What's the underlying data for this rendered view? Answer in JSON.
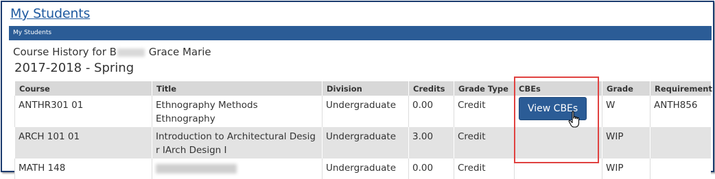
{
  "header": {
    "title": "My Students",
    "section_label": "My Students"
  },
  "history": {
    "prefix": "Course History for B",
    "suffix": "Grace Marie",
    "term": "2017-2018 - Spring"
  },
  "table": {
    "columns": [
      "Course",
      "Title",
      "Division",
      "Credits",
      "Grade Type",
      "CBEs",
      "Grade",
      "Requirement"
    ],
    "rows": [
      {
        "course": "ANTHR301 01",
        "title": "Ethnography Methods Ethnography",
        "division": "Undergraduate",
        "credits": "0.00",
        "grade_type": "Credit",
        "cbe_button": "View CBEs",
        "grade": "W",
        "requirement": "ANTH856"
      },
      {
        "course": "ARCH 101 01",
        "title": "Introduction to Architectural Desig r IArch Design I",
        "division": "Undergraduate",
        "credits": "3.00",
        "grade_type": "Credit",
        "grade": "WIP",
        "requirement": ""
      },
      {
        "course": "MATH 148",
        "title": "",
        "division": "Undergraduate",
        "credits": "0.00",
        "grade_type": "Credit",
        "grade": "WIP",
        "requirement": ""
      }
    ]
  },
  "colors": {
    "brand_blue": "#2b5c96",
    "highlight_red": "#e0413f",
    "link_blue": "#1f5aa0"
  }
}
